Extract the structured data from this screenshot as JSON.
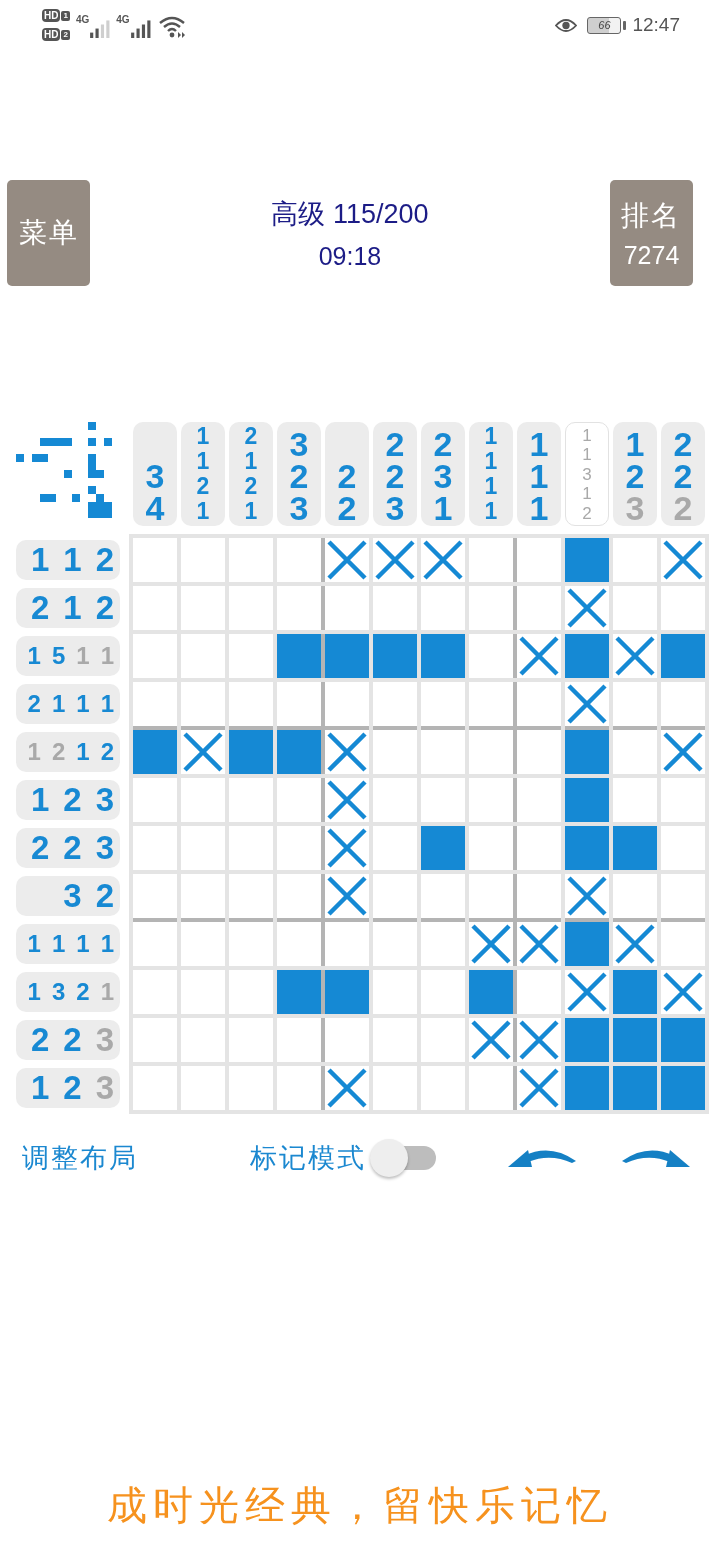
{
  "status_bar": {
    "sim_badges": [
      {
        "label": "HD",
        "slot": "1"
      },
      {
        "label": "HD",
        "slot": "2"
      }
    ],
    "networks": [
      {
        "type": "4G"
      },
      {
        "type": "4G"
      }
    ],
    "battery": "66",
    "time": "12:47"
  },
  "header": {
    "menu_button": "菜单",
    "title": "高级 115/200",
    "timer": "09:18",
    "rank_button": {
      "label": "排名",
      "value": "7274"
    }
  },
  "puzzle": {
    "column_clues": [
      {
        "complete": false,
        "numbers": [
          {
            "value": "3",
            "done": false
          },
          {
            "value": "4",
            "done": false
          }
        ]
      },
      {
        "complete": false,
        "numbers": [
          {
            "value": "1",
            "done": false
          },
          {
            "value": "1",
            "done": false
          },
          {
            "value": "2",
            "done": false
          },
          {
            "value": "1",
            "done": false
          }
        ]
      },
      {
        "complete": false,
        "numbers": [
          {
            "value": "2",
            "done": false
          },
          {
            "value": "1",
            "done": false
          },
          {
            "value": "2",
            "done": false
          },
          {
            "value": "1",
            "done": false
          }
        ]
      },
      {
        "complete": false,
        "numbers": [
          {
            "value": "3",
            "done": false
          },
          {
            "value": "2",
            "done": false
          },
          {
            "value": "3",
            "done": false
          }
        ]
      },
      {
        "complete": false,
        "numbers": [
          {
            "value": "2",
            "done": false
          },
          {
            "value": "2",
            "done": false
          }
        ]
      },
      {
        "complete": false,
        "numbers": [
          {
            "value": "2",
            "done": false
          },
          {
            "value": "2",
            "done": false
          },
          {
            "value": "3",
            "done": false
          }
        ]
      },
      {
        "complete": false,
        "numbers": [
          {
            "value": "2",
            "done": false
          },
          {
            "value": "3",
            "done": false
          },
          {
            "value": "1",
            "done": false
          }
        ]
      },
      {
        "complete": false,
        "numbers": [
          {
            "value": "1",
            "done": false
          },
          {
            "value": "1",
            "done": false
          },
          {
            "value": "1",
            "done": false
          },
          {
            "value": "1",
            "done": false
          }
        ]
      },
      {
        "complete": false,
        "numbers": [
          {
            "value": "1",
            "done": false
          },
          {
            "value": "1",
            "done": false
          },
          {
            "value": "1",
            "done": false
          }
        ]
      },
      {
        "complete": true,
        "numbers": [
          {
            "value": "1",
            "done": true
          },
          {
            "value": "1",
            "done": true
          },
          {
            "value": "3",
            "done": true
          },
          {
            "value": "1",
            "done": true
          },
          {
            "value": "2",
            "done": true
          }
        ]
      },
      {
        "complete": false,
        "numbers": [
          {
            "value": "1",
            "done": false
          },
          {
            "value": "2",
            "done": false
          },
          {
            "value": "3",
            "done": true
          }
        ]
      },
      {
        "complete": false,
        "numbers": [
          {
            "value": "2",
            "done": false
          },
          {
            "value": "2",
            "done": false
          },
          {
            "value": "2",
            "done": true
          }
        ]
      }
    ],
    "row_clues": [
      {
        "numbers": [
          {
            "value": "1",
            "done": false
          },
          {
            "value": "1",
            "done": false
          },
          {
            "value": "2",
            "done": false
          }
        ]
      },
      {
        "numbers": [
          {
            "value": "2",
            "done": false
          },
          {
            "value": "1",
            "done": false
          },
          {
            "value": "2",
            "done": false
          }
        ]
      },
      {
        "numbers": [
          {
            "value": "1",
            "done": false
          },
          {
            "value": "5",
            "done": false
          },
          {
            "value": "1",
            "done": true
          },
          {
            "value": "1",
            "done": true
          }
        ]
      },
      {
        "numbers": [
          {
            "value": "2",
            "done": false
          },
          {
            "value": "1",
            "done": false
          },
          {
            "value": "1",
            "done": false
          },
          {
            "value": "1",
            "done": false
          }
        ]
      },
      {
        "numbers": [
          {
            "value": "1",
            "done": true
          },
          {
            "value": "2",
            "done": true
          },
          {
            "value": "1",
            "done": false
          },
          {
            "value": "2",
            "done": false
          }
        ]
      },
      {
        "numbers": [
          {
            "value": "1",
            "done": false
          },
          {
            "value": "2",
            "done": false
          },
          {
            "value": "3",
            "done": false
          }
        ]
      },
      {
        "numbers": [
          {
            "value": "2",
            "done": false
          },
          {
            "value": "2",
            "done": false
          },
          {
            "value": "3",
            "done": false
          }
        ]
      },
      {
        "numbers": [
          {
            "value": "3",
            "done": false
          },
          {
            "value": "2",
            "done": false
          }
        ]
      },
      {
        "numbers": [
          {
            "value": "1",
            "done": false
          },
          {
            "value": "1",
            "done": false
          },
          {
            "value": "1",
            "done": false
          },
          {
            "value": "1",
            "done": false
          }
        ]
      },
      {
        "numbers": [
          {
            "value": "1",
            "done": false
          },
          {
            "value": "3",
            "done": false
          },
          {
            "value": "2",
            "done": false
          },
          {
            "value": "1",
            "done": true
          }
        ]
      },
      {
        "numbers": [
          {
            "value": "2",
            "done": false
          },
          {
            "value": "2",
            "done": false
          },
          {
            "value": "3",
            "done": true
          }
        ]
      },
      {
        "numbers": [
          {
            "value": "1",
            "done": false
          },
          {
            "value": "2",
            "done": false
          },
          {
            "value": "3",
            "done": true
          }
        ]
      }
    ],
    "rows": [
      {
        "cells": [
          {
            "filled": false,
            "crossed": false
          },
          {
            "filled": false,
            "crossed": false
          },
          {
            "filled": false,
            "crossed": false
          },
          {
            "filled": false,
            "crossed": false
          },
          {
            "filled": false,
            "crossed": true
          },
          {
            "filled": false,
            "crossed": true
          },
          {
            "filled": false,
            "crossed": true
          },
          {
            "filled": false,
            "crossed": false
          },
          {
            "filled": false,
            "crossed": false
          },
          {
            "filled": true,
            "crossed": false
          },
          {
            "filled": false,
            "crossed": false
          },
          {
            "filled": false,
            "crossed": true
          }
        ]
      },
      {
        "cells": [
          {
            "filled": false,
            "crossed": false
          },
          {
            "filled": false,
            "crossed": false
          },
          {
            "filled": false,
            "crossed": false
          },
          {
            "filled": false,
            "crossed": false
          },
          {
            "filled": false,
            "crossed": false
          },
          {
            "filled": false,
            "crossed": false
          },
          {
            "filled": false,
            "crossed": false
          },
          {
            "filled": false,
            "crossed": false
          },
          {
            "filled": false,
            "crossed": false
          },
          {
            "filled": false,
            "crossed": true
          },
          {
            "filled": false,
            "crossed": false
          },
          {
            "filled": false,
            "crossed": false
          }
        ]
      },
      {
        "cells": [
          {
            "filled": false,
            "crossed": false
          },
          {
            "filled": false,
            "crossed": false
          },
          {
            "filled": false,
            "crossed": false
          },
          {
            "filled": true,
            "crossed": false
          },
          {
            "filled": true,
            "crossed": false
          },
          {
            "filled": true,
            "crossed": false
          },
          {
            "filled": true,
            "crossed": false
          },
          {
            "filled": false,
            "crossed": false
          },
          {
            "filled": false,
            "crossed": true
          },
          {
            "filled": true,
            "crossed": false
          },
          {
            "filled": false,
            "crossed": true
          },
          {
            "filled": true,
            "crossed": false
          }
        ]
      },
      {
        "cells": [
          {
            "filled": false,
            "crossed": false
          },
          {
            "filled": false,
            "crossed": false
          },
          {
            "filled": false,
            "crossed": false
          },
          {
            "filled": false,
            "crossed": false
          },
          {
            "filled": false,
            "crossed": false
          },
          {
            "filled": false,
            "crossed": false
          },
          {
            "filled": false,
            "crossed": false
          },
          {
            "filled": false,
            "crossed": false
          },
          {
            "filled": false,
            "crossed": false
          },
          {
            "filled": false,
            "crossed": true
          },
          {
            "filled": false,
            "crossed": false
          },
          {
            "filled": false,
            "crossed": false
          }
        ]
      },
      {
        "cells": [
          {
            "filled": true,
            "crossed": false
          },
          {
            "filled": false,
            "crossed": true
          },
          {
            "filled": true,
            "crossed": false
          },
          {
            "filled": true,
            "crossed": false
          },
          {
            "filled": false,
            "crossed": true
          },
          {
            "filled": false,
            "crossed": false
          },
          {
            "filled": false,
            "crossed": false
          },
          {
            "filled": false,
            "crossed": false
          },
          {
            "filled": false,
            "crossed": false
          },
          {
            "filled": true,
            "crossed": false
          },
          {
            "filled": false,
            "crossed": false
          },
          {
            "filled": false,
            "crossed": true
          }
        ]
      },
      {
        "cells": [
          {
            "filled": false,
            "crossed": false
          },
          {
            "filled": false,
            "crossed": false
          },
          {
            "filled": false,
            "crossed": false
          },
          {
            "filled": false,
            "crossed": false
          },
          {
            "filled": false,
            "crossed": true
          },
          {
            "filled": false,
            "crossed": false
          },
          {
            "filled": false,
            "crossed": false
          },
          {
            "filled": false,
            "crossed": false
          },
          {
            "filled": false,
            "crossed": false
          },
          {
            "filled": true,
            "crossed": false
          },
          {
            "filled": false,
            "crossed": false
          },
          {
            "filled": false,
            "crossed": false
          }
        ]
      },
      {
        "cells": [
          {
            "filled": false,
            "crossed": false
          },
          {
            "filled": false,
            "crossed": false
          },
          {
            "filled": false,
            "crossed": false
          },
          {
            "filled": false,
            "crossed": false
          },
          {
            "filled": false,
            "crossed": true
          },
          {
            "filled": false,
            "crossed": false
          },
          {
            "filled": true,
            "crossed": false
          },
          {
            "filled": false,
            "crossed": false
          },
          {
            "filled": false,
            "crossed": false
          },
          {
            "filled": true,
            "crossed": false
          },
          {
            "filled": true,
            "crossed": false
          },
          {
            "filled": false,
            "crossed": false
          }
        ]
      },
      {
        "cells": [
          {
            "filled": false,
            "crossed": false
          },
          {
            "filled": false,
            "crossed": false
          },
          {
            "filled": false,
            "crossed": false
          },
          {
            "filled": false,
            "crossed": false
          },
          {
            "filled": false,
            "crossed": true
          },
          {
            "filled": false,
            "crossed": false
          },
          {
            "filled": false,
            "crossed": false
          },
          {
            "filled": false,
            "crossed": false
          },
          {
            "filled": false,
            "crossed": false
          },
          {
            "filled": false,
            "crossed": true
          },
          {
            "filled": false,
            "crossed": false
          },
          {
            "filled": false,
            "crossed": false
          }
        ]
      },
      {
        "cells": [
          {
            "filled": false,
            "crossed": false
          },
          {
            "filled": false,
            "crossed": false
          },
          {
            "filled": false,
            "crossed": false
          },
          {
            "filled": false,
            "crossed": false
          },
          {
            "filled": false,
            "crossed": false
          },
          {
            "filled": false,
            "crossed": false
          },
          {
            "filled": false,
            "crossed": false
          },
          {
            "filled": false,
            "crossed": true
          },
          {
            "filled": false,
            "crossed": true
          },
          {
            "filled": true,
            "crossed": false
          },
          {
            "filled": false,
            "crossed": true
          },
          {
            "filled": false,
            "crossed": false
          }
        ]
      },
      {
        "cells": [
          {
            "filled": false,
            "crossed": false
          },
          {
            "filled": false,
            "crossed": false
          },
          {
            "filled": false,
            "crossed": false
          },
          {
            "filled": true,
            "crossed": false
          },
          {
            "filled": true,
            "crossed": false
          },
          {
            "filled": false,
            "crossed": false
          },
          {
            "filled": false,
            "crossed": false
          },
          {
            "filled": true,
            "crossed": false
          },
          {
            "filled": false,
            "crossed": false
          },
          {
            "filled": false,
            "crossed": true
          },
          {
            "filled": true,
            "crossed": false
          },
          {
            "filled": false,
            "crossed": true
          }
        ]
      },
      {
        "cells": [
          {
            "filled": false,
            "crossed": false
          },
          {
            "filled": false,
            "crossed": false
          },
          {
            "filled": false,
            "crossed": false
          },
          {
            "filled": false,
            "crossed": false
          },
          {
            "filled": false,
            "crossed": false
          },
          {
            "filled": false,
            "crossed": false
          },
          {
            "filled": false,
            "crossed": false
          },
          {
            "filled": false,
            "crossed": true
          },
          {
            "filled": false,
            "crossed": true
          },
          {
            "filled": true,
            "crossed": false
          },
          {
            "filled": true,
            "crossed": false
          },
          {
            "filled": true,
            "crossed": false
          }
        ]
      },
      {
        "cells": [
          {
            "filled": false,
            "crossed": false
          },
          {
            "filled": false,
            "crossed": false
          },
          {
            "filled": false,
            "crossed": false
          },
          {
            "filled": false,
            "crossed": false
          },
          {
            "filled": false,
            "crossed": true
          },
          {
            "filled": false,
            "crossed": false
          },
          {
            "filled": false,
            "crossed": false
          },
          {
            "filled": false,
            "crossed": false
          },
          {
            "filled": false,
            "crossed": true
          },
          {
            "filled": true,
            "crossed": false
          },
          {
            "filled": true,
            "crossed": false
          },
          {
            "filled": true,
            "crossed": false
          }
        ]
      }
    ]
  },
  "controls": {
    "layout_button": "调整布局",
    "mark_mode": {
      "label": "标记模式",
      "on": false
    }
  },
  "slogan": "成时光经典，留快乐记忆"
}
